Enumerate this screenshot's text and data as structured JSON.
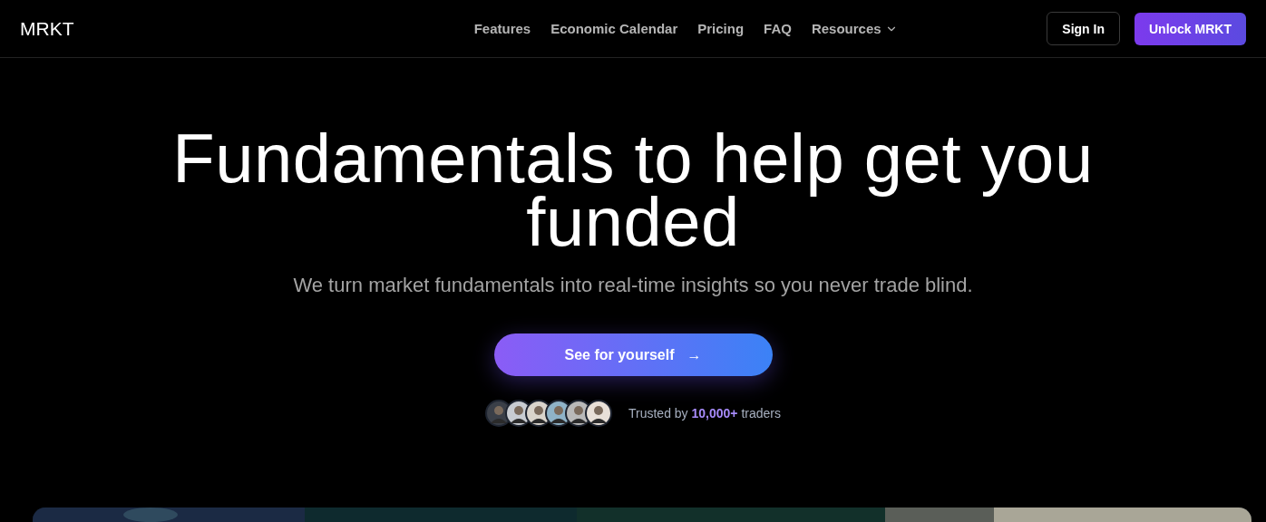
{
  "header": {
    "logo": "MRKT",
    "nav": [
      {
        "label": "Features",
        "dropdown": false
      },
      {
        "label": "Economic Calendar",
        "dropdown": false
      },
      {
        "label": "Pricing",
        "dropdown": false
      },
      {
        "label": "FAQ",
        "dropdown": false
      },
      {
        "label": "Resources",
        "dropdown": true
      }
    ],
    "sign_in": "Sign In",
    "cta": "Unlock MRKT"
  },
  "hero": {
    "headline_lines": [
      "Fundamentals to help get you",
      "funded"
    ],
    "subtitle": "We turn market fundamentals into real-time insights so you never trade blind.",
    "button": {
      "label": "See for yourself",
      "arrow": "→"
    },
    "avatars": [
      {
        "kind": "avatar"
      },
      {
        "kind": "avatar"
      },
      {
        "kind": "avatar"
      },
      {
        "kind": "avatar"
      },
      {
        "kind": "avatar"
      },
      {
        "kind": "avatar"
      }
    ],
    "trust_text": "Trusted by **10,000+** traders"
  }
}
